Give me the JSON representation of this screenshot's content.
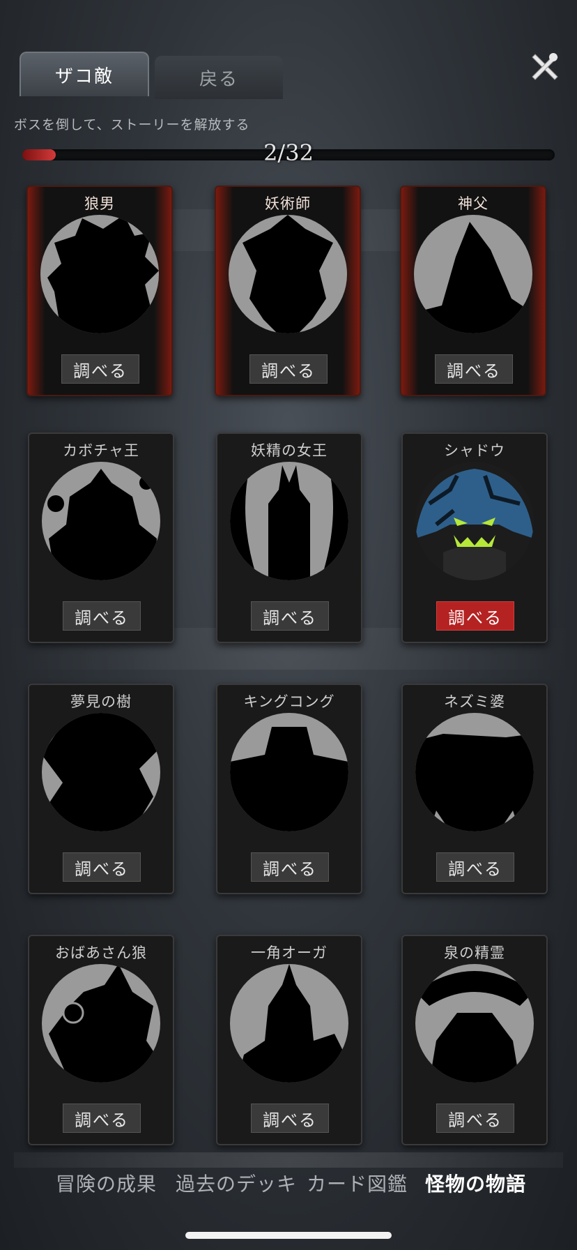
{
  "header": {
    "tabs": [
      {
        "label": "ザコ敵",
        "active": true
      },
      {
        "label": "戻る",
        "active": false
      }
    ],
    "close_icon": "close-icon"
  },
  "hint": "ボスを倒して、ストーリーを解放する",
  "progress": {
    "text": "2/32",
    "current": 2,
    "total": 32,
    "fraction": 0.0625
  },
  "colors": {
    "accent_red": "#b52222",
    "card_red_frame": "#7a1a0f",
    "shadow_blue": "#2e5f8a",
    "shadow_eyes": "#b6e83a"
  },
  "cards": [
    {
      "name": "狼男",
      "button": "調べる",
      "style": "red"
    },
    {
      "name": "妖術師",
      "button": "調べる",
      "style": "red"
    },
    {
      "name": "神父",
      "button": "調べる",
      "style": "red"
    },
    {
      "name": "カボチャ王",
      "button": "調べる",
      "style": "dark"
    },
    {
      "name": "妖精の女王",
      "button": "調べる",
      "style": "dark"
    },
    {
      "name": "シャドウ",
      "button": "調べる",
      "style": "dark",
      "unlocked": true
    },
    {
      "name": "夢見の樹",
      "button": "調べる",
      "style": "dark"
    },
    {
      "name": "キングコング",
      "button": "調べる",
      "style": "dark"
    },
    {
      "name": "ネズミ婆",
      "button": "調べる",
      "style": "dark"
    },
    {
      "name": "おばあさん狼",
      "button": "調べる",
      "style": "dark"
    },
    {
      "name": "一角オーガ",
      "button": "調べる",
      "style": "dark"
    },
    {
      "name": "泉の精霊",
      "button": "調べる",
      "style": "dark"
    }
  ],
  "bottom_nav": [
    {
      "label": "冒険の成果",
      "active": false
    },
    {
      "label": "過去のデッキ",
      "active": false
    },
    {
      "label": "カード図鑑",
      "active": false
    },
    {
      "label": "怪物の物語",
      "active": true
    }
  ]
}
